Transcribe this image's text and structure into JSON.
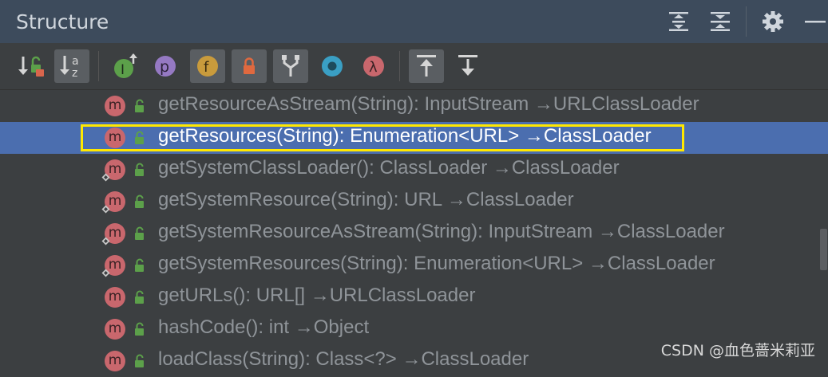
{
  "panel": {
    "title": "Structure"
  },
  "title_actions": [
    {
      "name": "expand-all-icon"
    },
    {
      "name": "collapse-all-icon"
    },
    {
      "name": "gear-icon"
    },
    {
      "name": "minimize-icon"
    }
  ],
  "toolbar": {
    "tools": [
      {
        "name": "sort-by-visibility-icon",
        "active": false
      },
      {
        "name": "sort-alphabetically-icon",
        "label": "az",
        "active": true
      },
      {
        "name": "show-inherited-icon",
        "label": "I",
        "active": false
      },
      {
        "name": "show-properties-icon",
        "label": "p",
        "active": false
      },
      {
        "name": "show-fields-icon",
        "label": "f",
        "active": true
      },
      {
        "name": "show-non-public-icon",
        "active": true
      },
      {
        "name": "show-anonymous-classes-icon",
        "active": true
      },
      {
        "name": "show-lambdas-icon",
        "active": false
      },
      {
        "name": "show-lambda-icon",
        "label": "λ",
        "active": false
      },
      {
        "name": "autoscroll-to-source-icon",
        "active": true
      },
      {
        "name": "autoscroll-from-source-icon",
        "active": false
      }
    ]
  },
  "colors": {
    "method_badge": "#c9676d",
    "selection": "#4b6eaf",
    "highlight": "#ffe800",
    "lock": "#5ca04a"
  },
  "members": [
    {
      "badge": "m",
      "label": "getResourceAsStream(String): InputStream →URLClassLoader",
      "overridden": false,
      "selected": false
    },
    {
      "badge": "m",
      "label": "getResources(String): Enumeration<URL> →ClassLoader",
      "overridden": false,
      "selected": true
    },
    {
      "badge": "m",
      "label": "getSystemClassLoader(): ClassLoader →ClassLoader",
      "overridden": true,
      "selected": false
    },
    {
      "badge": "m",
      "label": "getSystemResource(String): URL →ClassLoader",
      "overridden": true,
      "selected": false
    },
    {
      "badge": "m",
      "label": "getSystemResourceAsStream(String): InputStream →ClassLoader",
      "overridden": true,
      "selected": false
    },
    {
      "badge": "m",
      "label": "getSystemResources(String): Enumeration<URL> →ClassLoader",
      "overridden": true,
      "selected": false
    },
    {
      "badge": "m",
      "label": "getURLs(): URL[] →URLClassLoader",
      "overridden": false,
      "selected": false
    },
    {
      "badge": "m",
      "label": "hashCode(): int →Object",
      "overridden": false,
      "selected": false
    },
    {
      "badge": "m",
      "label": "loadClass(String): Class<?> →ClassLoader",
      "overridden": false,
      "selected": false
    }
  ],
  "watermark": "CSDN @血色蔷米莉亚"
}
